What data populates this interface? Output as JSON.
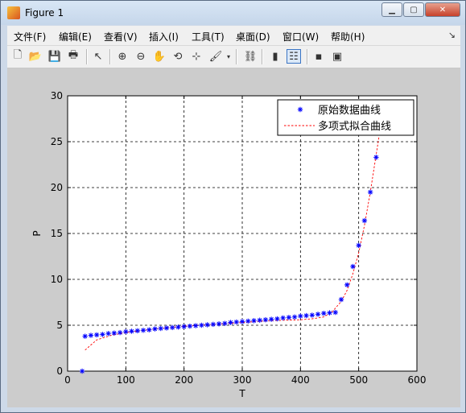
{
  "window": {
    "title": "Figure 1"
  },
  "menu": [
    "文件(F)",
    "编辑(E)",
    "查看(V)",
    "插入(I)",
    "工具(T)",
    "桌面(D)",
    "窗口(W)",
    "帮助(H)"
  ],
  "chart_data": {
    "type": "scatter",
    "title": "",
    "xlabel": "T",
    "ylabel": "P",
    "xlim": [
      0,
      600
    ],
    "ylim": [
      0,
      30
    ],
    "x_ticks": [
      0,
      100,
      200,
      300,
      400,
      500,
      600
    ],
    "y_ticks": [
      0,
      5,
      10,
      15,
      20,
      25,
      30
    ],
    "grid": true,
    "legend_position": "top-right",
    "series": [
      {
        "name": "原始数据曲线",
        "style": "marker-asterisk",
        "color": "#0000ff",
        "x": [
          25,
          30,
          40,
          50,
          60,
          70,
          80,
          90,
          100,
          110,
          120,
          130,
          140,
          150,
          160,
          170,
          180,
          190,
          200,
          210,
          220,
          230,
          240,
          250,
          260,
          270,
          280,
          290,
          300,
          310,
          320,
          330,
          340,
          350,
          360,
          370,
          380,
          390,
          400,
          410,
          420,
          430,
          440,
          450,
          460,
          470,
          480,
          490,
          500,
          510,
          520,
          530
        ],
        "y": [
          0,
          3.8,
          3.9,
          3.95,
          4.0,
          4.1,
          4.15,
          4.2,
          4.3,
          4.35,
          4.4,
          4.45,
          4.5,
          4.6,
          4.65,
          4.7,
          4.75,
          4.8,
          4.85,
          4.9,
          4.95,
          5.0,
          5.05,
          5.1,
          5.15,
          5.2,
          5.3,
          5.35,
          5.4,
          5.45,
          5.5,
          5.55,
          5.6,
          5.65,
          5.7,
          5.8,
          5.85,
          5.9,
          6.0,
          6.05,
          6.1,
          6.2,
          6.3,
          6.35,
          6.4,
          7.8,
          9.4,
          11.4,
          13.7,
          16.4,
          19.5,
          23.3
        ]
      },
      {
        "name": "多项式拟合曲线",
        "style": "dashed-line",
        "color": "#ff0000",
        "x": [
          30,
          50,
          75,
          100,
          125,
          150,
          175,
          200,
          225,
          250,
          275,
          300,
          325,
          350,
          375,
          400,
          420,
          440,
          455,
          470,
          480,
          490,
          500,
          510,
          520,
          530,
          535
        ],
        "y": [
          2.3,
          3.4,
          3.9,
          4.2,
          4.4,
          4.6,
          4.75,
          4.9,
          5.0,
          5.1,
          5.2,
          5.3,
          5.4,
          5.5,
          5.55,
          5.6,
          5.7,
          5.9,
          6.5,
          7.6,
          8.8,
          10.6,
          12.9,
          15.9,
          19.5,
          23.6,
          25.6
        ]
      }
    ]
  }
}
